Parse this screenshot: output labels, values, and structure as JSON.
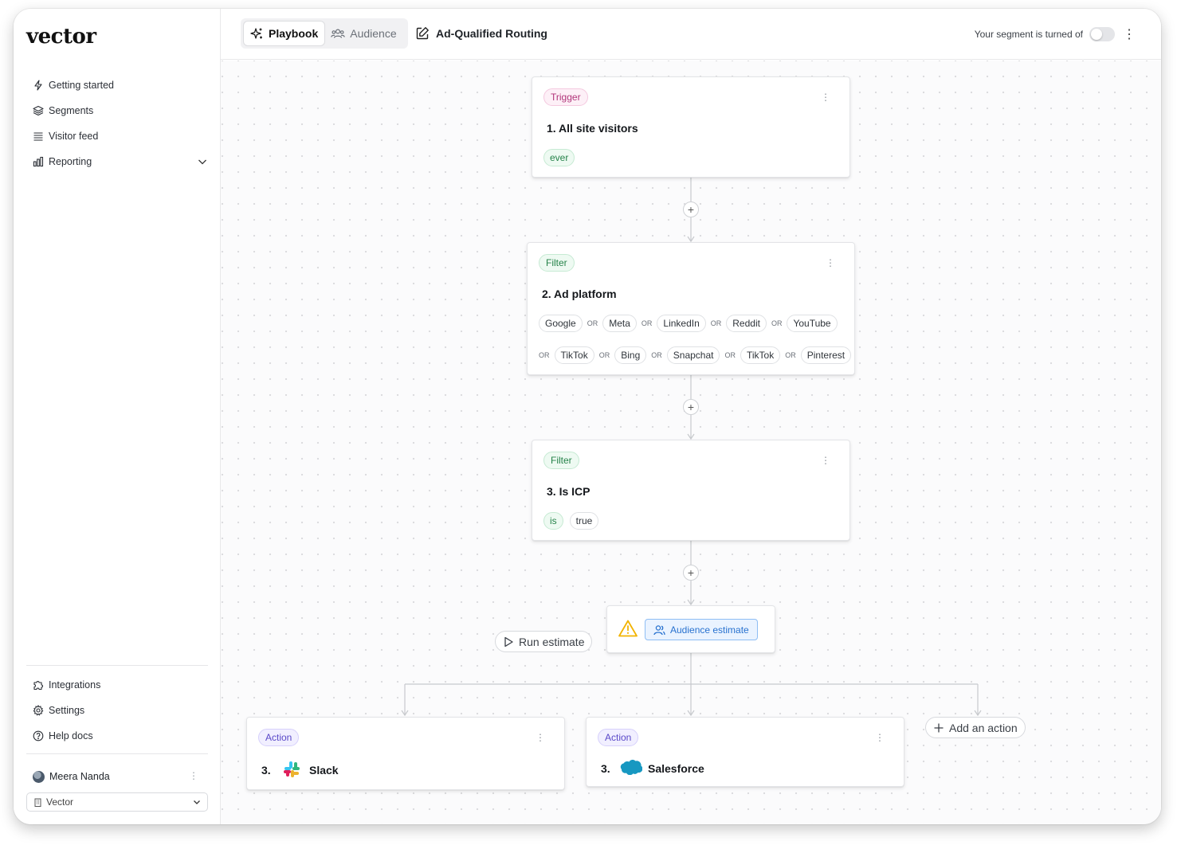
{
  "app": {
    "logo": "vector"
  },
  "sidebar": {
    "items": [
      {
        "label": "Getting started",
        "icon": "bolt-icon"
      },
      {
        "label": "Segments",
        "icon": "layers-icon"
      },
      {
        "label": "Visitor feed",
        "icon": "list-icon"
      },
      {
        "label": "Reporting",
        "icon": "bar-chart-icon"
      }
    ],
    "bottom_items": [
      {
        "label": "Integrations",
        "icon": "puzzle-icon"
      },
      {
        "label": "Settings",
        "icon": "gear-icon"
      },
      {
        "label": "Help docs",
        "icon": "help-icon"
      }
    ],
    "user": {
      "name": "Meera Nanda"
    },
    "org": {
      "name": "Vector"
    }
  },
  "header": {
    "tabs": [
      {
        "label": "Playbook",
        "active": true
      },
      {
        "label": "Audience",
        "active": false
      }
    ],
    "title": "Ad-Qualified Routing",
    "status_text": "Your segment is turned of",
    "toggle_on": false
  },
  "flow": {
    "trigger": {
      "badge": "Trigger",
      "title": "1. All site visitors",
      "chips": [
        "ever"
      ]
    },
    "filter1": {
      "badge": "Filter",
      "title": "2. Ad platform",
      "or_label": "OR",
      "row1": [
        "Google",
        "Meta",
        "LinkedIn",
        "Reddit",
        "YouTube"
      ],
      "row2": [
        "TikTok",
        "Bing",
        "Snapchat",
        "TikTok",
        "Pinterest"
      ]
    },
    "filter2": {
      "badge": "Filter",
      "title": "3. Is ICP",
      "chips": [
        "is",
        "true"
      ]
    },
    "run_estimate": "Run estimate",
    "audience_estimate": "Audience estimate",
    "actions": [
      {
        "badge": "Action",
        "number": "3.",
        "name": "Slack"
      },
      {
        "badge": "Action",
        "number": "3.",
        "name": "Salesforce"
      }
    ],
    "add_action": "Add an action"
  },
  "colors": {
    "trigger": "#b1357a",
    "filter": "#26834a",
    "action": "#5a49c8",
    "estimate": "#2771cf",
    "warning": "#f2b300"
  }
}
